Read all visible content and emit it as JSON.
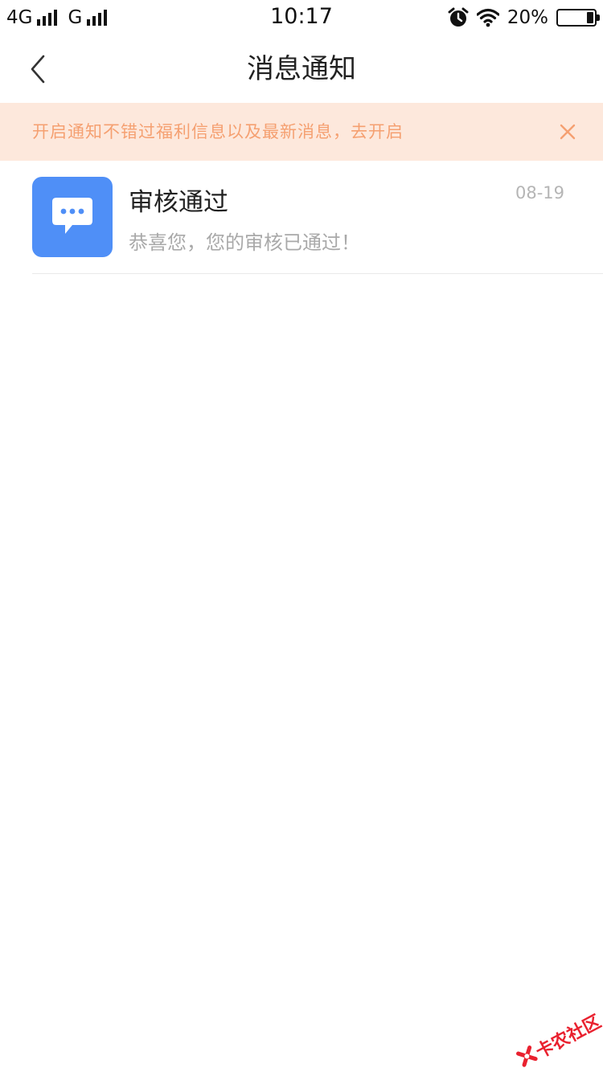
{
  "status_bar": {
    "network_1": "4G",
    "network_2": "G",
    "time": "10:17",
    "battery": "20%",
    "battery_level": 0.2,
    "icons": [
      "signal-icon",
      "alarm-icon",
      "wifi-icon",
      "battery-icon"
    ]
  },
  "header": {
    "title": "消息通知",
    "back_icon": "chevron-left-icon"
  },
  "notice": {
    "text": "开启通知不错过福利信息以及最新消息，去开启",
    "text_color": "#f5a071",
    "background": "#fde8dc",
    "close_icon": "close-icon"
  },
  "messages": [
    {
      "title": "审核通过",
      "body": "恭喜您，您的审核已通过！",
      "date": "08-19",
      "icon": "chat-bubble-icon",
      "icon_background": "#4f8ff7"
    }
  ],
  "watermark": {
    "text": "卡农社区",
    "color": "#e9212f"
  }
}
